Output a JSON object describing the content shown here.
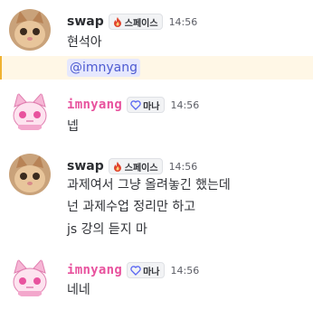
{
  "messages": [
    {
      "author": "swap",
      "role_tag": "스페이스",
      "time": "14:56",
      "lines": [
        "현석아"
      ],
      "mention": "@imnyang"
    },
    {
      "author": "imnyang",
      "role_tag": "마나",
      "time": "14:56",
      "lines": [
        "넵"
      ]
    },
    {
      "author": "swap",
      "role_tag": "스페이스",
      "time": "14:56",
      "lines": [
        "과제여서 그냥 올려놓긴 했는데",
        "넌 과제수업 정리만 하고",
        "js 강의 듣지 마"
      ]
    },
    {
      "author": "imnyang",
      "role_tag": "마나",
      "time": "14:56",
      "lines": [
        "네네"
      ]
    }
  ],
  "colors": {
    "imnyang_name": "#e8539e",
    "mention_bg": "#e6e8fd",
    "mention_text": "#4e5bd1",
    "mention_bar": "#f0b232",
    "mention_row_bg": "#fff7e6"
  },
  "icons": {
    "swap_tag_icon": "flame-icon",
    "imnyang_tag_icon": "heart-outline-icon"
  }
}
